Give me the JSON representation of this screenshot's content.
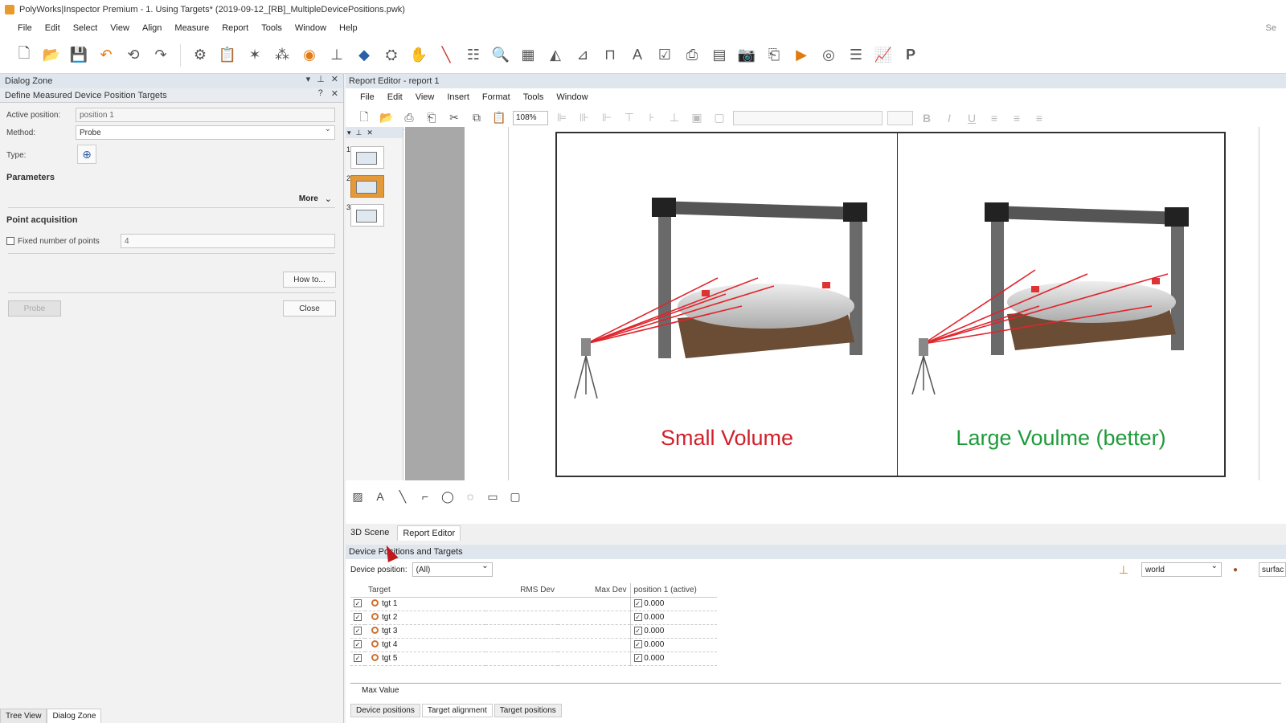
{
  "window": {
    "title": "PolyWorks|Inspector Premium - 1. Using Targets* (2019-09-12_[RB]_MultipleDevicePositions.pwk)"
  },
  "menu": [
    "File",
    "Edit",
    "Select",
    "View",
    "Align",
    "Measure",
    "Report",
    "Tools",
    "Window",
    "Help"
  ],
  "menu_right": "Se",
  "dialog": {
    "zone_title": "Dialog Zone",
    "panel_title": "Define Measured Device Position Targets",
    "active_position_label": "Active position:",
    "active_position_value": "position 1",
    "method_label": "Method:",
    "method_value": "Probe",
    "type_label": "Type:",
    "parameters_label": "Parameters",
    "more_label": "More",
    "point_acq_label": "Point acquisition",
    "fixed_points_label": "Fixed number of points",
    "fixed_points_value": "4",
    "howto_label": "How to...",
    "probe_label": "Probe",
    "close_label": "Close"
  },
  "left_tabs": [
    "Tree View",
    "Dialog Zone"
  ],
  "report": {
    "title": "Report Editor - report 1",
    "menu": [
      "File",
      "Edit",
      "View",
      "Insert",
      "Format",
      "Tools",
      "Window"
    ],
    "zoom": "108%",
    "caption_left": "Small Volume",
    "caption_right": "Large Voulme (better)",
    "colors": {
      "caption_left": "#d21f2a",
      "caption_right": "#1f9a3a"
    }
  },
  "thumbs": [
    "1",
    "2",
    "3"
  ],
  "mid_tabs": [
    "3D Scene",
    "Report Editor"
  ],
  "devices": {
    "title": "Device Positions and Targets",
    "device_position_label": "Device position:",
    "device_position_value": "(All)",
    "coord_value": "world",
    "right_value": "surfac",
    "headers": [
      "Target",
      "RMS Dev",
      "Max Dev",
      "position 1 (active)"
    ],
    "rows": [
      {
        "name": "tgt 1",
        "value": "0.000"
      },
      {
        "name": "tgt 2",
        "value": "0.000"
      },
      {
        "name": "tgt 3",
        "value": "0.000"
      },
      {
        "name": "tgt 4",
        "value": "0.000"
      },
      {
        "name": "tgt 5",
        "value": "0.000"
      }
    ],
    "max_value_label": "Max Value",
    "bottom_tabs": [
      "Device positions",
      "Target alignment",
      "Target positions"
    ]
  }
}
